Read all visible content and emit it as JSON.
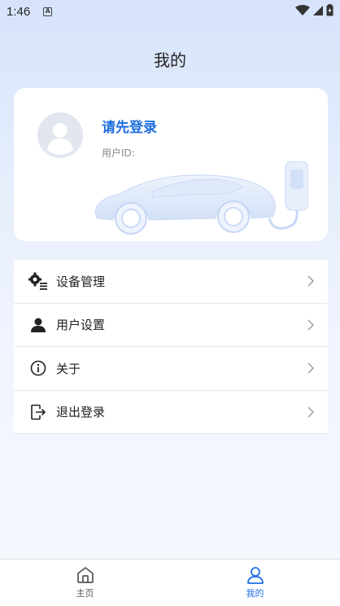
{
  "status_bar": {
    "time": "1:46",
    "notification_icon": "A"
  },
  "header": {
    "title": "我的"
  },
  "profile": {
    "login_prompt": "请先登录",
    "user_id_label": "用户ID:"
  },
  "menu": {
    "items": [
      {
        "label": "设备管理",
        "icon": "gears-list-icon"
      },
      {
        "label": "用户设置",
        "icon": "person-icon"
      },
      {
        "label": "关于",
        "icon": "info-icon"
      },
      {
        "label": "退出登录",
        "icon": "logout-icon"
      }
    ]
  },
  "tabbar": {
    "tabs": [
      {
        "label": "主页",
        "icon": "home-icon",
        "active": false
      },
      {
        "label": "我的",
        "icon": "person-outline-icon",
        "active": true
      }
    ]
  },
  "colors": {
    "accent": "#1f6fe0",
    "background_top": "#d6e3fb",
    "card": "#ffffff"
  }
}
